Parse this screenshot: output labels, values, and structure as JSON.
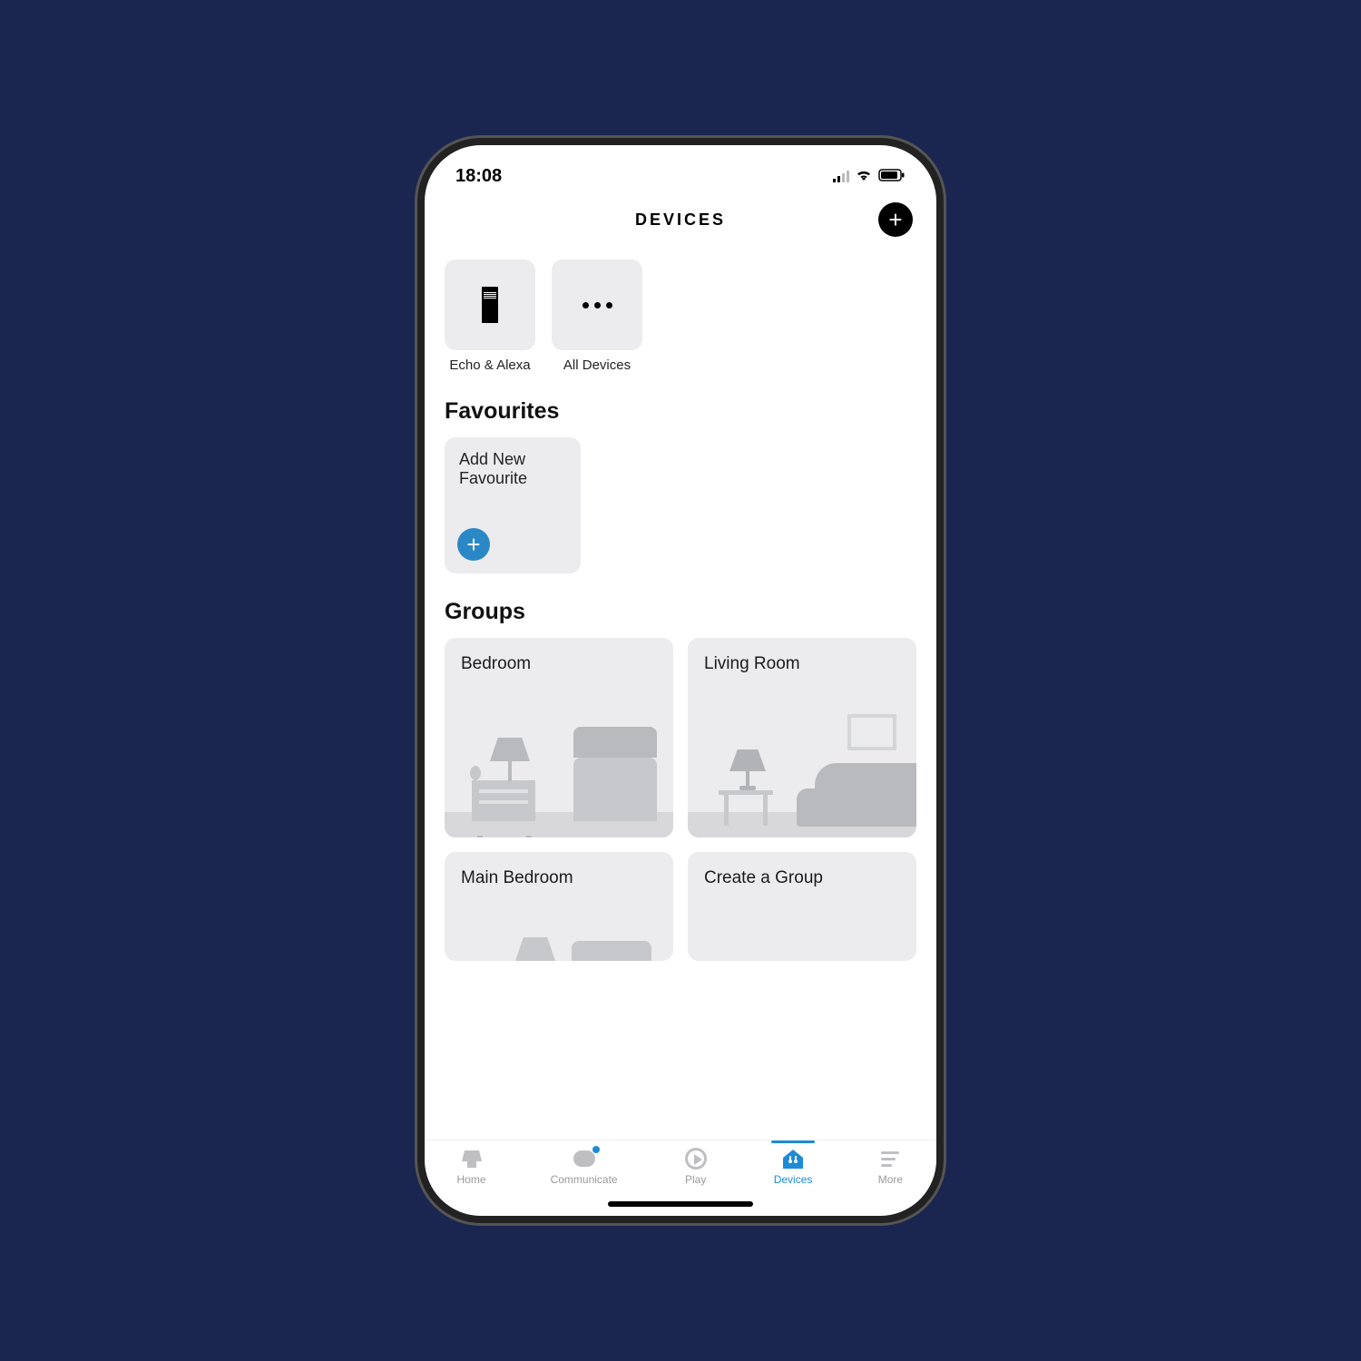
{
  "status": {
    "time": "18:08"
  },
  "header": {
    "title": "DEVICES",
    "add_label": "+"
  },
  "quick_tiles": [
    {
      "id": "echo",
      "label": "Echo & Alexa"
    },
    {
      "id": "all",
      "label": "All Devices"
    }
  ],
  "sections": {
    "favourites_title": "Favourites",
    "groups_title": "Groups"
  },
  "favourites": {
    "add_card_line1": "Add New",
    "add_card_line2": "Favourite"
  },
  "groups": [
    {
      "name": "Bedroom"
    },
    {
      "name": "Living Room"
    },
    {
      "name": "Main Bedroom"
    },
    {
      "name": "Create a Group"
    }
  ],
  "tabs": [
    {
      "id": "home",
      "label": "Home"
    },
    {
      "id": "communicate",
      "label": "Communicate"
    },
    {
      "id": "play",
      "label": "Play"
    },
    {
      "id": "devices",
      "label": "Devices",
      "active": true
    },
    {
      "id": "more",
      "label": "More"
    }
  ]
}
